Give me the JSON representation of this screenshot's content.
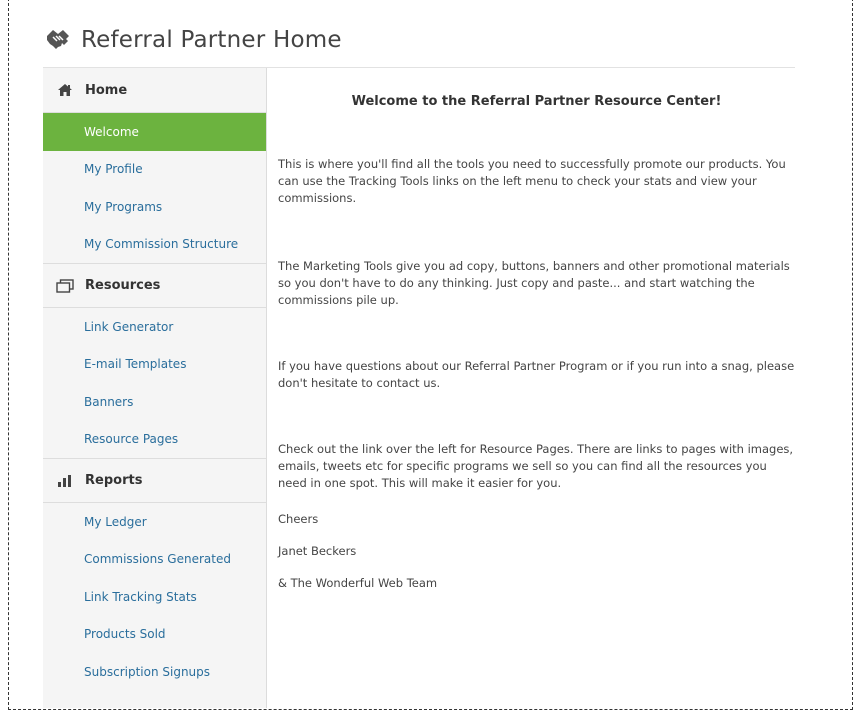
{
  "header": {
    "title": "Referral Partner Home",
    "logo_icon": "handshake-icon"
  },
  "sidebar": {
    "sections": [
      {
        "label": "Home",
        "icon": "home-icon",
        "items": [
          "Welcome",
          "My Profile",
          "My Programs",
          "My Commission Structure"
        ],
        "active": "Welcome"
      },
      {
        "label": "Resources",
        "icon": "windows-icon",
        "items": [
          "Link Generator",
          "E-mail Templates",
          "Banners",
          "Resource Pages"
        ]
      },
      {
        "label": "Reports",
        "icon": "bar-chart-icon",
        "items": [
          "My Ledger",
          "Commissions Generated",
          "Link Tracking Stats",
          "Products Sold",
          "Subscription Signups"
        ]
      }
    ]
  },
  "main": {
    "heading": "Welcome to the Referral Partner Resource Center!",
    "paragraphs": [
      "This is where you'll find all the tools you need to successfully promote our products. You can use the Tracking Tools links on the left menu to check your stats and view your commissions.",
      "The Marketing Tools give you ad copy, buttons, banners and other promotional materials so you don't have to do any thinking. Just copy and paste... and start watching the commissions pile up.",
      "If you have questions about our Referral Partner Program or if you run into a snag, please don't hesitate to contact us.",
      "Check out the link over the left for Resource Pages. There are links to pages with images, emails, tweets etc for specific programs we sell so you can find all the resources you need in one spot. This will make it easier for you.",
      "Cheers",
      "Janet Beckers",
      "& The Wonderful Web Team"
    ]
  },
  "colors": {
    "active_bg": "#6cb33f",
    "link": "#2a6e9c",
    "sidebar_bg": "#f5f5f5"
  }
}
